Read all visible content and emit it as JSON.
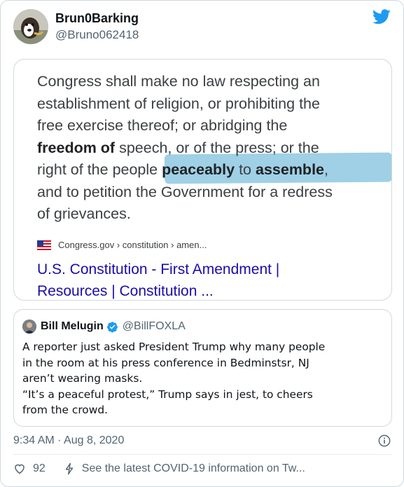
{
  "colors": {
    "twitter_blue": "#1d9bf0",
    "link": "#1a0dab",
    "highlight": "#50aad2",
    "muted": "#536471"
  },
  "tweet": {
    "author_name": "Brun0Barking",
    "author_handle": "@Bruno062418",
    "timestamp": "9:34 AM · Aug 8, 2020",
    "like_count": "92",
    "covid_notice": "See the latest COVID-19 information on Tw..."
  },
  "constitution": {
    "line1": "Congress shall make no law respecting an",
    "line2": "establishment of religion, or prohibiting the",
    "line3": "free exercise thereof; or abridging the",
    "line4_bold": "freedom of",
    "line4_rest": " speech, or of the press; or the",
    "line5_pre": "right of the people ",
    "line5_b1": "peaceably",
    "line5_mid": " to ",
    "line5_b2": "assemble",
    "line5_end": ",",
    "line6": "and to petition the Government for a redress",
    "line7": "of grievances.",
    "source": "Congress.gov › constitution › amen...",
    "link_line1": "U.S. Constitution - First Amendment |",
    "link_line2": "Resources | Constitution ..."
  },
  "quote": {
    "name": "Bill Melugin",
    "handle": "@BillFOXLA",
    "text": "A reporter just asked President Trump why many people\nin the room at his press conference in Bedminstsr, NJ\naren’t wearing masks.\n“It’s a peaceful protest,” Trump says in jest, to cheers\nfrom the crowd."
  },
  "icons": {
    "brand": "twitter-bird-icon",
    "verified": "verified-badge-icon",
    "info": "info-icon",
    "like": "heart-icon",
    "covid": "covid-bolt-icon",
    "flag": "us-flag-icon"
  }
}
